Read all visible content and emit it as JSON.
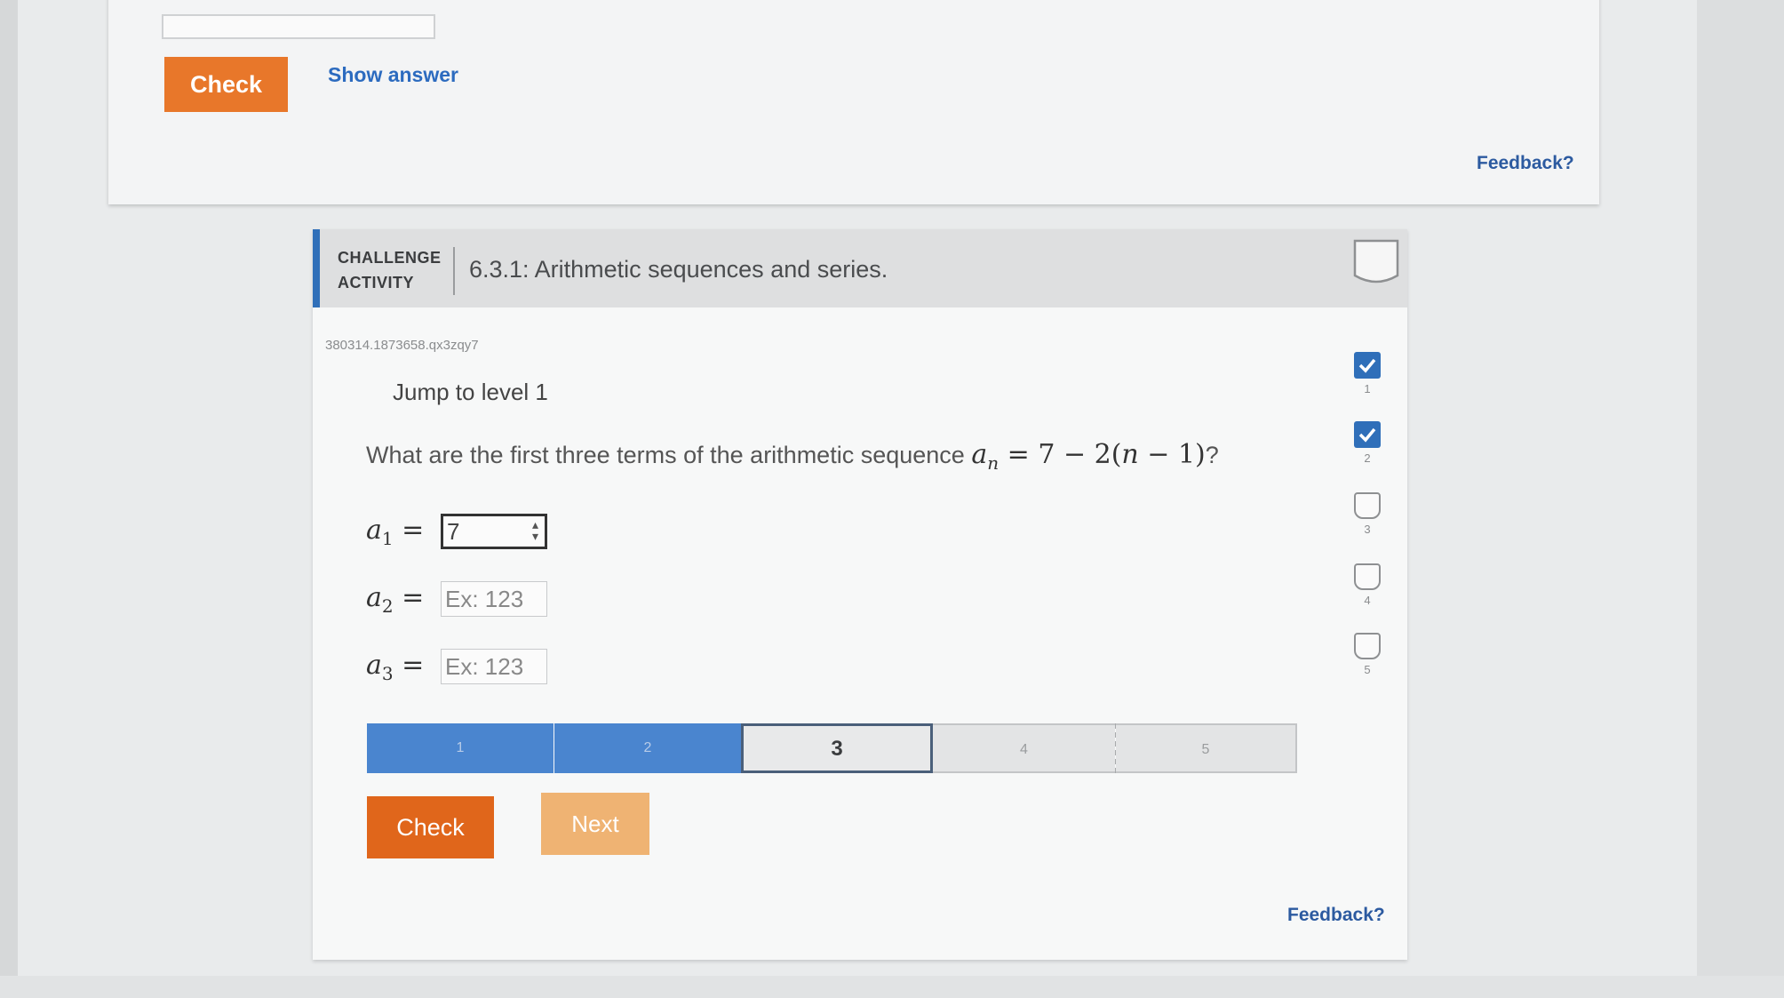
{
  "top": {
    "check_label": "Check",
    "show_answer_label": "Show answer",
    "feedback_label": "Feedback?"
  },
  "challenge": {
    "header_label_line1": "CHALLENGE",
    "header_label_line2": "ACTIVITY",
    "title": "6.3.1: Arithmetic sequences and series.",
    "activity_id": "380314.1873658.qx3zqy7",
    "jump_label": "Jump to level 1",
    "question_text": "What are the first three terms of the arithmetic sequence",
    "question_end": "?",
    "answers": [
      {
        "value": "7",
        "placeholder": "Ex: 123"
      },
      {
        "value": "",
        "placeholder": "Ex: 123"
      },
      {
        "value": "",
        "placeholder": "Ex: 123"
      }
    ],
    "progress": {
      "segments": [
        "1",
        "2",
        "3",
        "4",
        "5"
      ],
      "completed": 2,
      "current": 3
    },
    "check_label": "Check",
    "next_label": "Next",
    "feedback_label": "Feedback?",
    "levels": [
      {
        "num": "1",
        "checked": true
      },
      {
        "num": "2",
        "checked": true
      },
      {
        "num": "3",
        "checked": false
      },
      {
        "num": "4",
        "checked": false
      },
      {
        "num": "5",
        "checked": false
      }
    ]
  },
  "colors": {
    "accent_blue": "#2f6fb9",
    "check_orange": "#e0661b",
    "next_orange_light": "#efb373",
    "progress_done": "#4a85cf",
    "link_blue": "#2c5aa0"
  }
}
